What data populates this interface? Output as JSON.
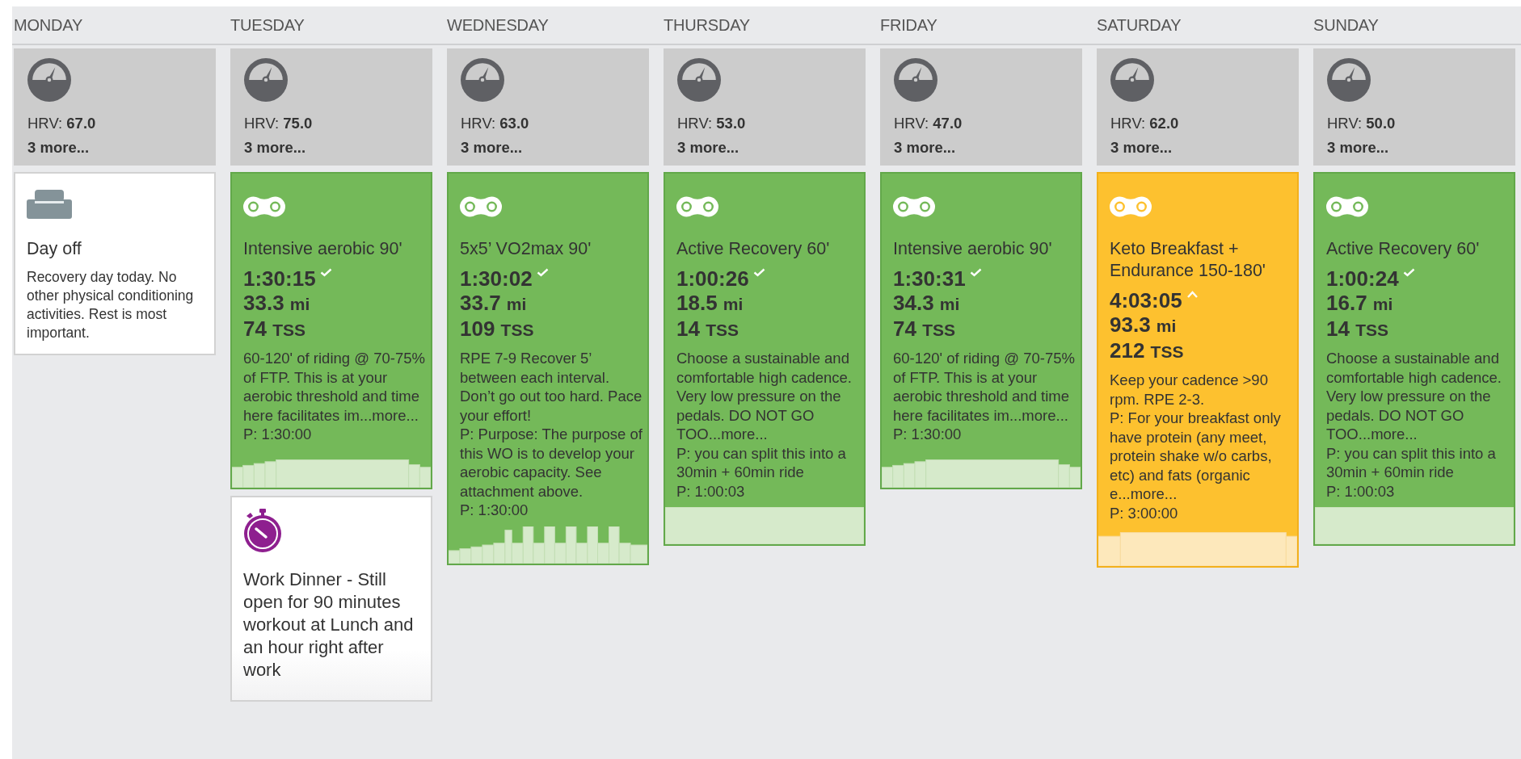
{
  "days": [
    {
      "name": "MONDAY",
      "metrics": {
        "hrv": "HRV: **67.0**",
        "more": "3 more..."
      },
      "items": [
        {
          "kind": "day_off",
          "title": "Day off",
          "notes": [
            "Recovery day today. No other physical conditioning activities. Rest is most important."
          ]
        }
      ]
    },
    {
      "name": "TUESDAY",
      "metrics": {
        "hrv": "HRV: **75.0**",
        "more": "3 more..."
      },
      "items": [
        {
          "kind": "bike",
          "over_plan": false,
          "title": "Intensive aerobic 90'",
          "duration": "1:30:15",
          "distance": {
            "value": "33.3",
            "unit": "mi"
          },
          "tss": {
            "value": "74",
            "unit": "TSS"
          },
          "notes": [
            "60-120' of riding @ 70-75% of FTP. This is at your aerobic threshold and time here facilitates im...more...",
            "P: 1:30:00"
          ],
          "profile": {
            "kind": "steady"
          }
        },
        {
          "kind": "event",
          "title": "Work Dinner - Still open for 90 minutes workout at Lunch and an hour right after work"
        }
      ]
    },
    {
      "name": "WEDNESDAY",
      "metrics": {
        "hrv": "HRV: **63.0**",
        "more": "3 more..."
      },
      "items": [
        {
          "kind": "bike",
          "over_plan": false,
          "title": "5x5’ VO2max 90'",
          "duration": "1:30:02",
          "distance": {
            "value": "33.7",
            "unit": "mi"
          },
          "tss": {
            "value": "109",
            "unit": "TSS"
          },
          "notes": [
            "RPE 7-9 Recover 5’ between each interval. Don’t go out too hard. Pace your effort!",
            "P: Purpose: The purpose of this WO is to develop your aerobic capacity. See attachment above.",
            "P: 1:30:00"
          ],
          "profile": {
            "kind": "intervals"
          }
        }
      ]
    },
    {
      "name": "THURSDAY",
      "metrics": {
        "hrv": "HRV: **53.0**",
        "more": "3 more..."
      },
      "items": [
        {
          "kind": "bike",
          "over_plan": false,
          "title": "Active Recovery 60'",
          "duration": "1:00:26",
          "distance": {
            "value": "18.5",
            "unit": "mi"
          },
          "tss": {
            "value": "14",
            "unit": "TSS"
          },
          "notes": [
            "Choose a sustainable and comfortable high cadence. Very low pressure on the pedals. DO NOT GO TOO...more...",
            "P: you can split this into a 30min + 60min ride",
            "P: 1:00:03"
          ],
          "profile": {
            "kind": "flat"
          }
        }
      ]
    },
    {
      "name": "FRIDAY",
      "metrics": {
        "hrv": "HRV: **47.0**",
        "more": "3 more..."
      },
      "items": [
        {
          "kind": "bike",
          "over_plan": false,
          "title": "Intensive aerobic 90'",
          "duration": "1:30:31",
          "distance": {
            "value": "34.3",
            "unit": "mi"
          },
          "tss": {
            "value": "74",
            "unit": "TSS"
          },
          "notes": [
            "60-120' of riding @ 70-75% of FTP. This is at your aerobic threshold and time here facilitates im...more...",
            "P: 1:30:00"
          ],
          "profile": {
            "kind": "steady"
          }
        }
      ]
    },
    {
      "name": "SATURDAY",
      "metrics": {
        "hrv": "HRV: **62.0**",
        "more": "3 more..."
      },
      "items": [
        {
          "kind": "bike",
          "over_plan": true,
          "title": "Keto Breakfast + Endurance 150-180'",
          "duration": "4:03:05",
          "distance": {
            "value": "93.3",
            "unit": "mi"
          },
          "tss": {
            "value": "212",
            "unit": "TSS"
          },
          "notes": [
            "Keep your cadence >90 rpm. RPE 2-3.",
            "P: For your breakfast only have protein (any meet, protein shake w/o carbs, etc) and fats (organic e...more...",
            "P: 3:00:00"
          ],
          "profile": {
            "kind": "long"
          }
        }
      ]
    },
    {
      "name": "SUNDAY",
      "metrics": {
        "hrv": "HRV: **50.0**",
        "more": "3 more..."
      },
      "items": [
        {
          "kind": "bike",
          "over_plan": false,
          "title": "Active Recovery 60'",
          "duration": "1:00:24",
          "distance": {
            "value": "16.7",
            "unit": "mi"
          },
          "tss": {
            "value": "14",
            "unit": "TSS"
          },
          "notes": [
            "Choose a sustainable and comfortable high cadence. Very low pressure on the pedals. DO NOT GO TOO...more...",
            "P: you can split this into a 30min + 60min ride",
            "P: 1:00:03"
          ],
          "profile": {
            "kind": "flat"
          }
        }
      ]
    }
  ]
}
